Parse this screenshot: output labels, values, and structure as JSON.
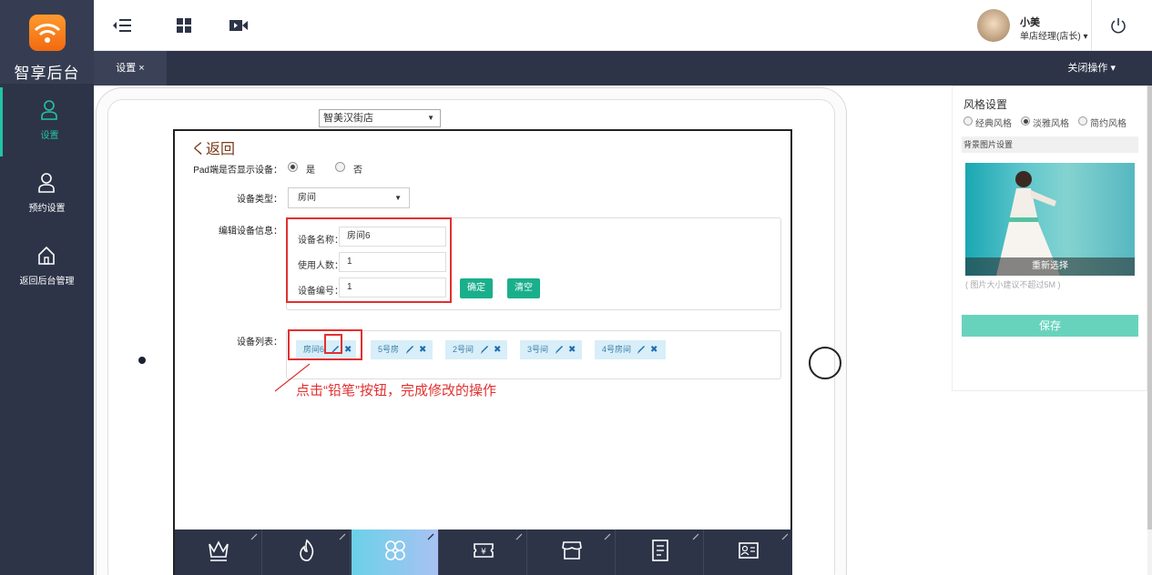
{
  "app": {
    "logo_text": "智享后台"
  },
  "sidebar": {
    "items": [
      {
        "label": "设置",
        "icon": "user-icon",
        "active": true
      },
      {
        "label": "预约设置",
        "icon": "user-icon"
      },
      {
        "label": "返回后台管理",
        "icon": "home-icon"
      }
    ]
  },
  "header": {
    "icons": [
      "menu-collapse-icon",
      "grid-icon",
      "video-icon"
    ],
    "user_name": "小美",
    "user_role": "单店经理(店长)",
    "role_caret": "▾",
    "power_icon": "power-icon"
  },
  "tabs": {
    "items": [
      {
        "label": "设置 ×"
      }
    ],
    "close_ops": "关闭操作 ▾"
  },
  "device": {
    "store_select": "智美汉街店",
    "back": "く返回",
    "pad_show_label": "Pad端是否显示设备：",
    "pad_show_yes": "是",
    "pad_show_no": "否",
    "pad_show_value": "是",
    "type_label": "设备类型：",
    "type_value": "房间",
    "edit_label": "编辑设备信息：",
    "name_label": "设备名称：",
    "name_value": "房间6",
    "people_label": "使用人数：",
    "people_value": "1",
    "number_label": "设备编号：",
    "number_value": "1",
    "confirm_btn": "确定",
    "clear_btn": "清空",
    "list_label": "设备列表：",
    "chips": [
      "房间6",
      "5号房",
      "2号间",
      "3号间",
      "4号房间"
    ],
    "annotation": "点击“铅笔”按钮，完成修改的操作"
  },
  "bottom_nav": {
    "items": [
      {
        "label": "精品",
        "icon": "crown-icon"
      },
      {
        "label": "热门",
        "icon": "flame-icon"
      },
      {
        "label": "产品",
        "icon": "clover-icon",
        "active": true
      },
      {
        "label": "优惠",
        "icon": "coupon-icon"
      },
      {
        "label": "形象",
        "icon": "store-icon"
      },
      {
        "label": "资讯",
        "icon": "document-icon"
      },
      {
        "label": "账户",
        "icon": "id-card-icon"
      }
    ]
  },
  "style_panel": {
    "title": "风格设置",
    "options": [
      "经典风格",
      "淡雅风格",
      "简约风格"
    ],
    "selected": "淡雅风格",
    "bg_label": "背景图片设置",
    "reselect": "重新选择",
    "hint": "( 图片大小建议不超过5M )",
    "save": "保存"
  },
  "colors": {
    "accent": "#1aaf8b",
    "sidebar": "#2d3448",
    "highlight": "#e23030"
  }
}
